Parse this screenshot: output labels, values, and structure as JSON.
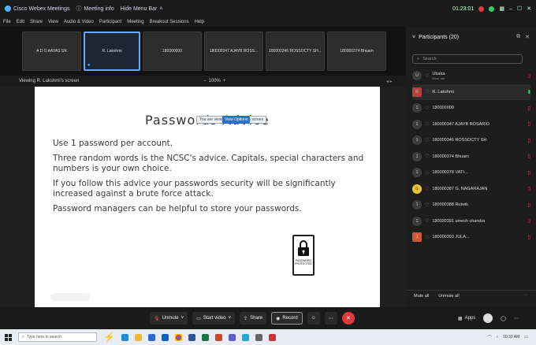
{
  "window": {
    "app_title": "Cisco Webex Meetings",
    "meeting_info_label": "Meeting info",
    "hide_menu_label": "Hide Menu Bar",
    "time": "01:23:01"
  },
  "menubar": {
    "items": [
      "File",
      "Edit",
      "Share",
      "View",
      "Audio & Video",
      "Participant",
      "Meeting",
      "Breakout Sessions",
      "Help"
    ]
  },
  "tiles": [
    {
      "name": "A D O AAVAS SR",
      "active": false
    },
    {
      "name": "R. Lakshmi",
      "active": true
    },
    {
      "name": "180000000",
      "active": false
    },
    {
      "name": "180000347 AJAYB ROSS...",
      "active": false
    },
    {
      "name": "180000346 ROSSOCTY SH...",
      "active": false
    },
    {
      "name": "180000374 Bhuam",
      "active": false
    }
  ],
  "view_bar": {
    "label": "Viewing R. Lakshmi's screen",
    "zoom": "100%"
  },
  "slide": {
    "title": "Passwords Advice",
    "share_badge": "You are viewing R. Lakshmi's screen",
    "stop_label": "View Options",
    "lines": [
      "Use 1 password per account.",
      "Three random words is the NCSC's advice. Capitals, special characters and numbers is your own choice.",
      "If you follow this advice your passwords security will be significantly increased against a brute force attack.",
      "Password managers can be helpful to store your passwords."
    ],
    "lock_text": "PASSWORD PROTECTED"
  },
  "participants": {
    "header": "Participants (20)",
    "search_placeholder": "Search",
    "list": [
      {
        "name": "Ubaka",
        "sub": "Host, me",
        "avatar": "U",
        "avatar_style": "gray",
        "status": "muted",
        "selected": false
      },
      {
        "name": "R. Lakshmi",
        "sub": "",
        "avatar": "R",
        "avatar_style": "red",
        "status": "unmuted",
        "selected": true
      },
      {
        "name": "180000000",
        "sub": "",
        "avatar": "1",
        "avatar_style": "gray",
        "status": "muted",
        "selected": false
      },
      {
        "name": "180000347 AJAYB ROSARIO",
        "sub": "",
        "avatar": "1",
        "avatar_style": "gray",
        "status": "muted",
        "selected": false
      },
      {
        "name": "180000346 ROSSOCTY SH",
        "sub": "",
        "avatar": "1",
        "avatar_style": "gray",
        "status": "muted",
        "selected": false
      },
      {
        "name": "180000374 Bhuam",
        "sub": "",
        "avatar": "1",
        "avatar_style": "gray",
        "status": "muted",
        "selected": false
      },
      {
        "name": "180000378 VATI...",
        "sub": "",
        "avatar": "1",
        "avatar_style": "gray",
        "status": "muted",
        "selected": false
      },
      {
        "name": "180000387 G. NAGARAJAN",
        "sub": "",
        "avatar": "G",
        "avatar_style": "yellow",
        "status": "muted",
        "selected": false
      },
      {
        "name": "180000388 Rutwik",
        "sub": "",
        "avatar": "1",
        "avatar_style": "gray",
        "status": "muted",
        "selected": false
      },
      {
        "name": "180000391 umesh chandra",
        "sub": "",
        "avatar": "1",
        "avatar_style": "gray",
        "status": "muted",
        "selected": false
      },
      {
        "name": "180000393 JULA...",
        "sub": "",
        "avatar": "J",
        "avatar_style": "orange",
        "status": "muted",
        "selected": false
      }
    ],
    "mute_all_label": "Mute all",
    "unmute_all_label": "Unmute all"
  },
  "controls": {
    "unmute_label": "Unmute",
    "start_video_label": "Start video",
    "share_label": "Share",
    "record_label": "Record",
    "apps_label": "Apps"
  },
  "taskbar": {
    "search_placeholder": "Type here to search",
    "time": "10:33 AM"
  },
  "colors": {
    "accent": "#6aa6ff",
    "end_call": "#e23a3a",
    "muted": "#dd4444"
  }
}
